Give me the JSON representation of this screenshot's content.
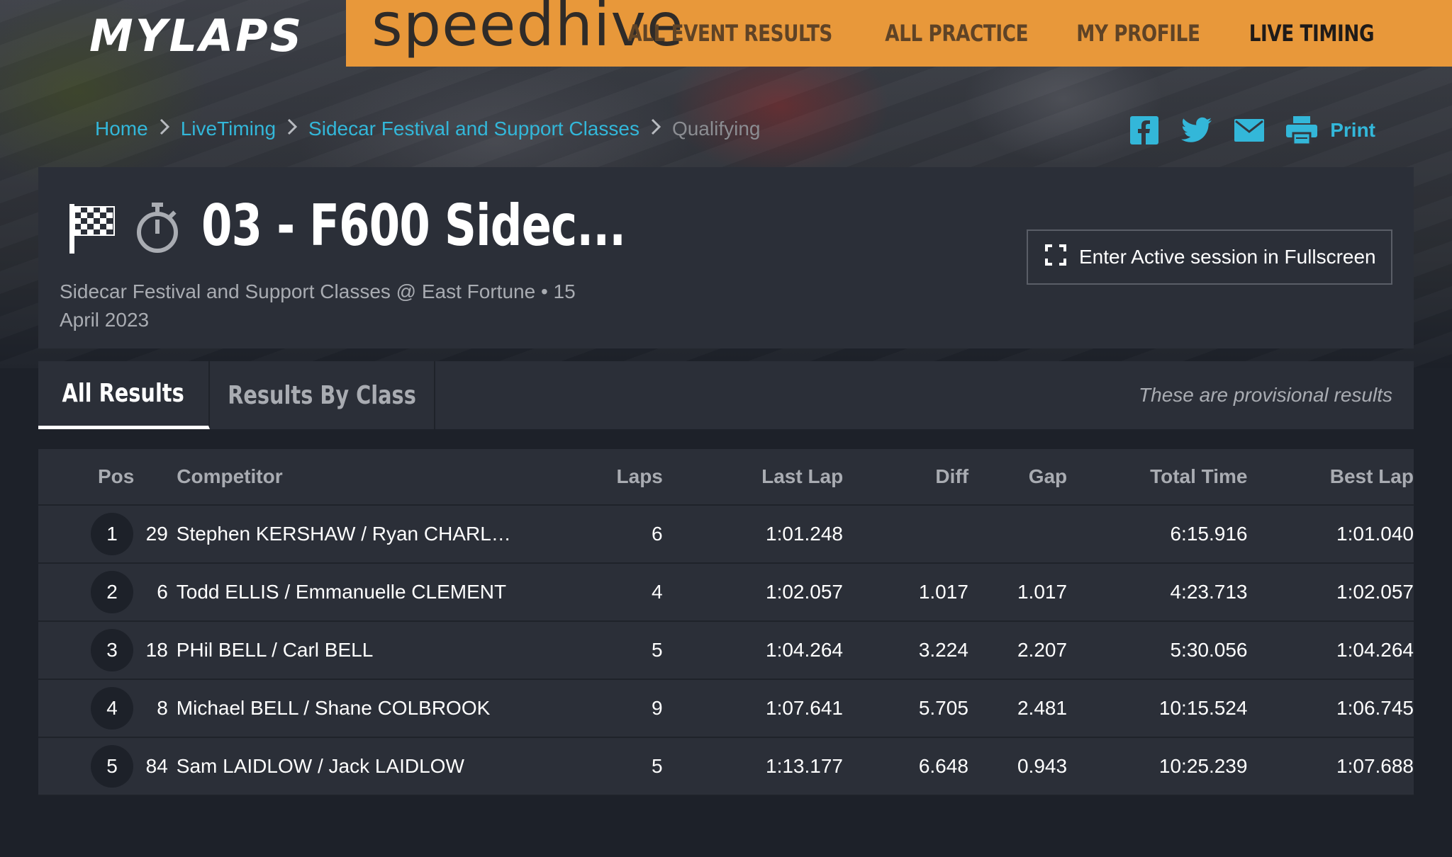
{
  "brand": {
    "mylaps": "MYLAPS",
    "speedhive": "speedhive"
  },
  "nav": [
    {
      "label": "ALL EVENT RESULTS"
    },
    {
      "label": "ALL PRACTICE"
    },
    {
      "label": "MY PROFILE"
    },
    {
      "label": "LIVE TIMING"
    }
  ],
  "breadcrumb": [
    "Home",
    "LiveTiming",
    "Sidecar Festival and Support Classes",
    "Qualifying"
  ],
  "share": {
    "print_label": "Print",
    "icons": [
      "facebook-icon",
      "twitter-icon",
      "mail-icon",
      "printer-icon"
    ]
  },
  "session": {
    "title": "03 - F600 Sidec...",
    "subtitle": "Sidecar Festival and Support Classes @ East Fortune • 15 April 2023",
    "fullscreen_label": "Enter Active session in Fullscreen"
  },
  "tabs": [
    {
      "label": "All Results"
    },
    {
      "label": "Results By Class"
    }
  ],
  "provisional_note": "These are provisional results",
  "table": {
    "headers": {
      "pos": "Pos",
      "competitor": "Competitor",
      "laps": "Laps",
      "last_lap": "Last Lap",
      "diff": "Diff",
      "gap": "Gap",
      "total_time": "Total Time",
      "best_lap": "Best Lap"
    },
    "rows": [
      {
        "pos": "1",
        "number": "29",
        "competitor": "Stephen KERSHAW / Ryan CHARL…",
        "laps": "6",
        "last_lap": "1:01.248",
        "diff": "",
        "gap": "",
        "total_time": "6:15.916",
        "best_lap": "1:01.040"
      },
      {
        "pos": "2",
        "number": "6",
        "competitor": "Todd ELLIS / Emmanuelle CLEMENT",
        "laps": "4",
        "last_lap": "1:02.057",
        "diff": "1.017",
        "gap": "1.017",
        "total_time": "4:23.713",
        "best_lap": "1:02.057"
      },
      {
        "pos": "3",
        "number": "18",
        "competitor": "PHil BELL / Carl BELL",
        "laps": "5",
        "last_lap": "1:04.264",
        "diff": "3.224",
        "gap": "2.207",
        "total_time": "5:30.056",
        "best_lap": "1:04.264"
      },
      {
        "pos": "4",
        "number": "8",
        "competitor": "Michael BELL / Shane COLBROOK",
        "laps": "9",
        "last_lap": "1:07.641",
        "diff": "5.705",
        "gap": "2.481",
        "total_time": "10:15.524",
        "best_lap": "1:06.745"
      },
      {
        "pos": "5",
        "number": "84",
        "competitor": "Sam LAIDLOW / Jack LAIDLOW",
        "laps": "5",
        "last_lap": "1:13.177",
        "diff": "6.648",
        "gap": "0.943",
        "total_time": "10:25.239",
        "best_lap": "1:07.688"
      }
    ]
  },
  "colors": {
    "accent_orange": "#e8983a",
    "link_blue": "#33b7d9",
    "panel": "#2b2f38",
    "page_bg": "#1d2129"
  }
}
